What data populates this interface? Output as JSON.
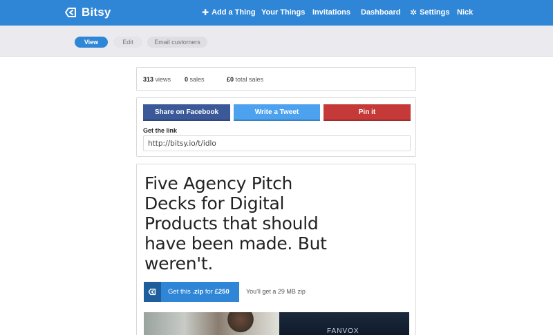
{
  "brand": {
    "name": "Bitsy"
  },
  "nav": {
    "add": "Add a Thing",
    "things": "Your Things",
    "invitations": "Invitations",
    "dashboard": "Dashboard",
    "settings": "Settings",
    "user": "Nick"
  },
  "tabs": {
    "view": "View",
    "edit": "Edit",
    "email": "Email customers"
  },
  "stats": {
    "views_value": "313",
    "views_label": "views",
    "sales_value": "0",
    "sales_label": "sales",
    "total_value": "£0",
    "total_label": "total sales"
  },
  "share": {
    "facebook": "Share on Facebook",
    "twitter": "Write a Tweet",
    "pinterest": "Pin it",
    "link_label": "Get the link",
    "link_value": "http://bitsy.io/t/idlo"
  },
  "product": {
    "title": "Five Agency Pitch Decks for Digital Products that should have been made. But weren't.",
    "buy_prefix": "Get this",
    "buy_ext": ".zip",
    "buy_for": "for",
    "buy_price": "£250",
    "zip_note": "You'll get a 29 MB zip",
    "media_brand": "FANVOX"
  },
  "colors": {
    "accent": "#2f86d6",
    "facebook": "#3b5998",
    "twitter": "#4da2ef",
    "pinterest": "#c53a38"
  }
}
